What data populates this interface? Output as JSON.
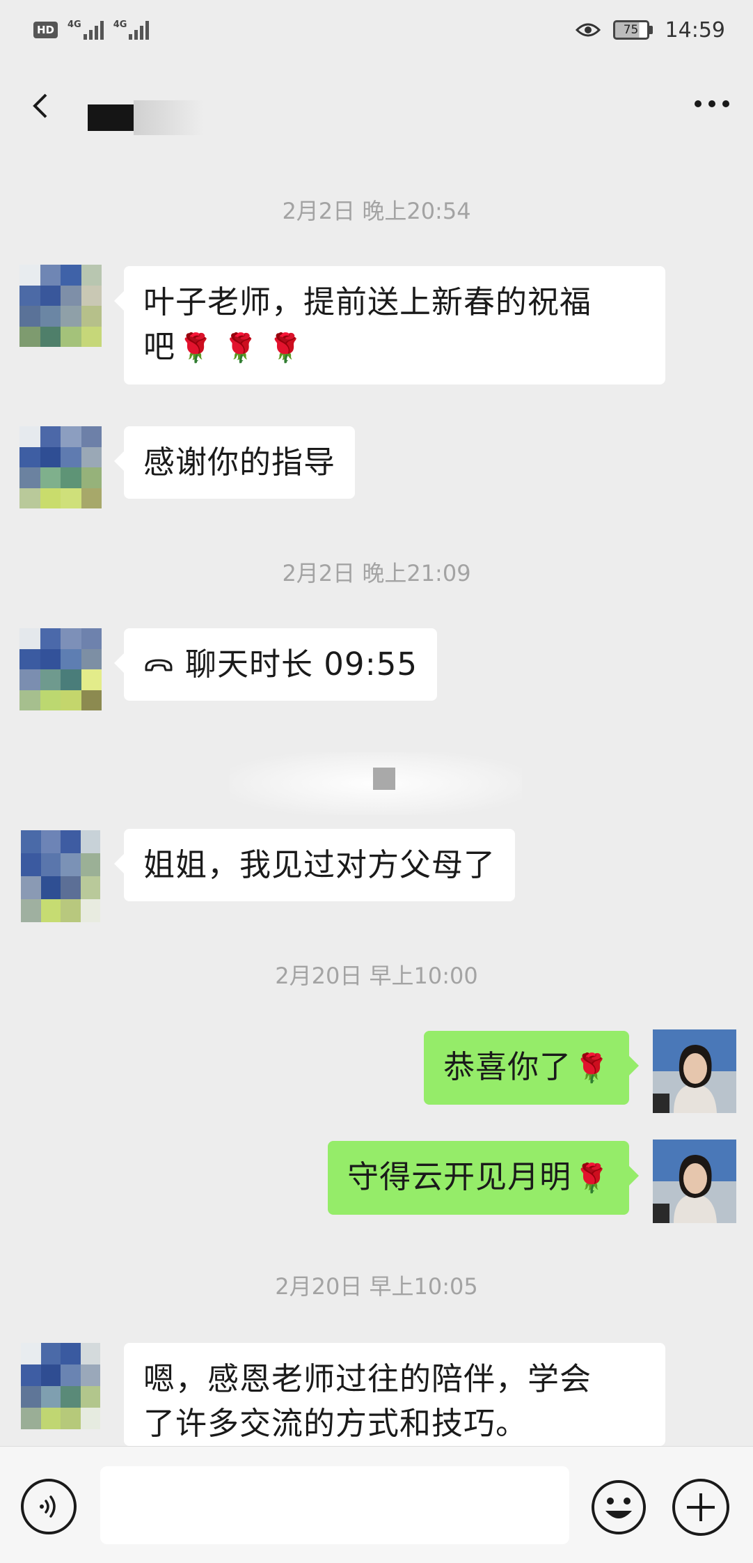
{
  "status_bar": {
    "hd": "HD",
    "net1": "4G",
    "net2": "4G",
    "battery": "75",
    "time": "14:59"
  },
  "messages": [
    {
      "type": "time",
      "text": "2月2日 晚上20:54"
    },
    {
      "type": "left",
      "text_line1": "叶子老师，提前送上新春的祝福",
      "text_line2": "吧",
      "emoji": "🌹 🌹 🌹"
    },
    {
      "type": "left",
      "text": "感谢你的指导"
    },
    {
      "type": "time",
      "text": "2月2日 晚上21:09"
    },
    {
      "type": "left-call",
      "text": "聊天时长 09:55"
    },
    {
      "type": "left",
      "text": "姐姐，我见过对方父母了"
    },
    {
      "type": "time",
      "text": "2月20日 早上10:00"
    },
    {
      "type": "right",
      "text": "恭喜你了",
      "emoji": "🌹"
    },
    {
      "type": "right",
      "text": "守得云开见月明",
      "emoji": "🌹"
    },
    {
      "type": "time",
      "text": "2月20日 早上10:05"
    },
    {
      "type": "left",
      "text_line1": "嗯，感恩老师过往的陪伴，学会",
      "text_line2": "了许多交流的方式和技巧。"
    }
  ],
  "icons": {
    "back": "chevron-left-icon",
    "more": "more-dots-icon",
    "voice": "voice-icon",
    "emoji": "emoji-icon",
    "plus": "plus-icon",
    "call": "phone-hangup-icon"
  },
  "colors": {
    "background": "#ededed",
    "bubble_left": "#ffffff",
    "bubble_right": "#95ec69",
    "timestamp": "#a3a3a3"
  }
}
